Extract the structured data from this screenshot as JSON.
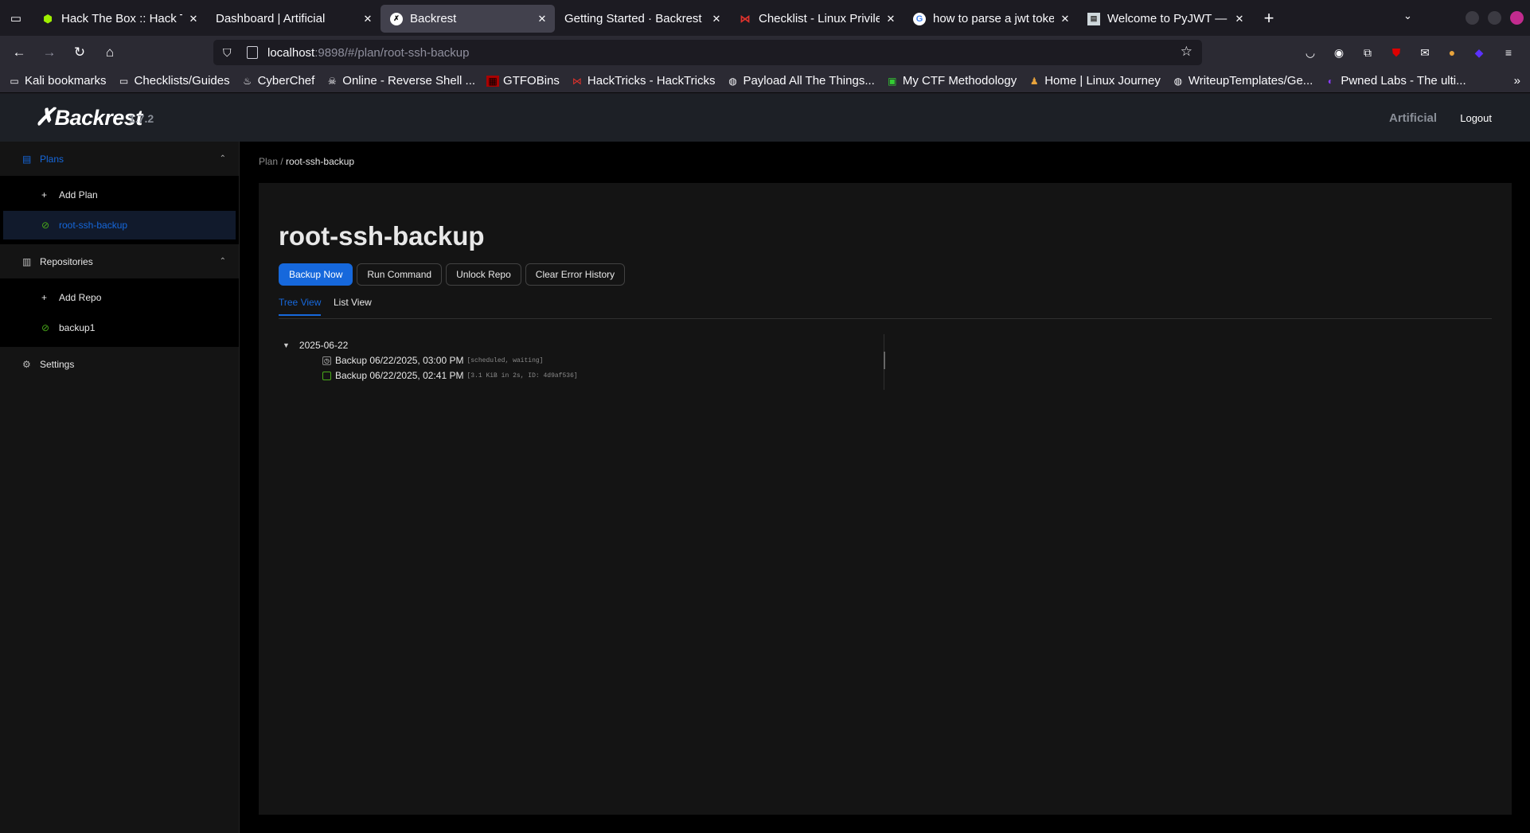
{
  "browser": {
    "tabs": [
      {
        "title": "Hack The Box :: Hack The Box",
        "icon": "htb-cube-icon",
        "active": false
      },
      {
        "title": "Dashboard | Artificial",
        "icon": "",
        "active": false
      },
      {
        "title": "Backrest",
        "icon": "backrest-icon",
        "active": true
      },
      {
        "title": "Getting Started · Backrest",
        "icon": "",
        "active": false
      },
      {
        "title": "Checklist - Linux Privilege Escalation",
        "icon": "hacktricks-icon",
        "active": false
      },
      {
        "title": "how to parse a jwt token python",
        "icon": "google-icon",
        "active": false
      },
      {
        "title": "Welcome to PyJWT — PyJWT",
        "icon": "pyjwt-icon",
        "active": false
      }
    ],
    "url_host": "localhost",
    "url_rest": ":9898/#/plan/root-ssh-backup",
    "bookmarks": [
      {
        "label": "Kali bookmarks",
        "icon": "folder-icon"
      },
      {
        "label": "Checklists/Guides",
        "icon": "folder-icon"
      },
      {
        "label": "CyberChef",
        "icon": "chef-icon"
      },
      {
        "label": "Online - Reverse Shell ...",
        "icon": "skull-icon"
      },
      {
        "label": "GTFOBins",
        "icon": "gtfobins-icon"
      },
      {
        "label": "HackTricks - HackTricks",
        "icon": "hacktricks-icon"
      },
      {
        "label": "Payload All The Things...",
        "icon": "github-icon"
      },
      {
        "label": "My CTF Methodology",
        "icon": "terminal-icon"
      },
      {
        "label": "Home | Linux Journey",
        "icon": "linux-icon"
      },
      {
        "label": "WriteupTemplates/Ge...",
        "icon": "github-icon"
      },
      {
        "label": "Pwned Labs - The ulti...",
        "icon": "pwnedlabs-icon"
      }
    ]
  },
  "app": {
    "logo": "Backrest",
    "version": "1.7.2",
    "instance": "Artificial",
    "logout": "Logout"
  },
  "sidebar": {
    "plans_label": "Plans",
    "add_plan": "Add Plan",
    "plan_item": "root-ssh-backup",
    "repos_label": "Repositories",
    "add_repo": "Add Repo",
    "repo_item": "backup1",
    "settings": "Settings"
  },
  "main": {
    "breadcrumb_root": "Plan",
    "breadcrumb_sep": " / ",
    "breadcrumb_current": "root-ssh-backup",
    "title": "root-ssh-backup",
    "buttons": {
      "backup_now": "Backup Now",
      "run_command": "Run Command",
      "unlock_repo": "Unlock Repo",
      "clear_errors": "Clear Error History"
    },
    "view_tabs": {
      "tree": "Tree View",
      "list": "List View"
    },
    "tree": {
      "date": "2025-06-22",
      "entries": [
        {
          "label": "Backup 06/22/2025, 03:00 PM",
          "meta": "[scheduled, waiting]",
          "status": "pending"
        },
        {
          "label": "Backup 06/22/2025, 02:41 PM",
          "meta": "[3.1 KiB in 2s, ID: 4d9af536]",
          "status": "success"
        }
      ]
    }
  },
  "colors": {
    "accent": "#1668dc",
    "success": "#49aa19"
  }
}
